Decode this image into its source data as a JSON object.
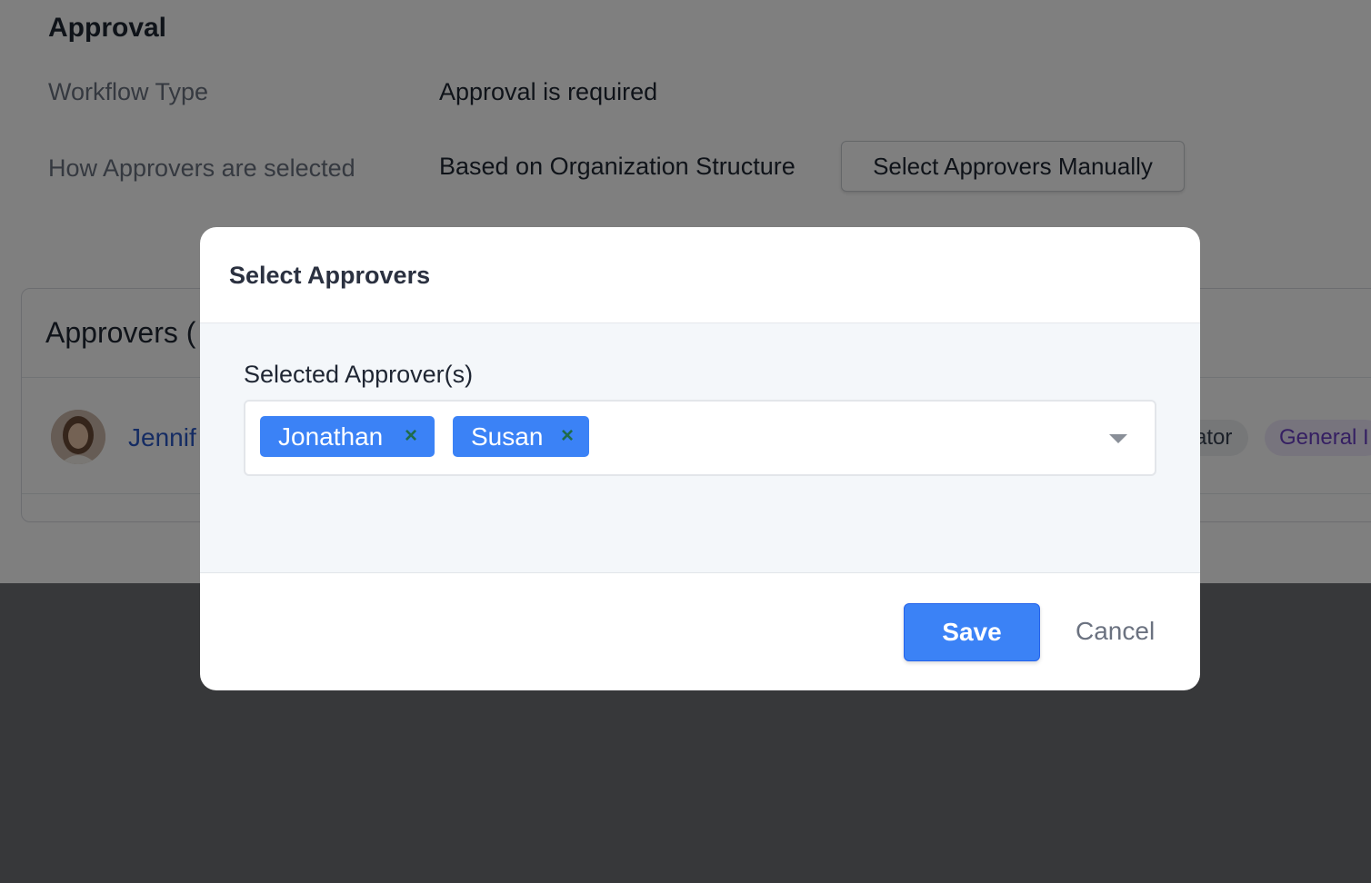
{
  "approval": {
    "title": "Approval",
    "workflow_type_label": "Workflow Type",
    "workflow_type_value": "Approval is required",
    "approvers_selected_label": "How Approvers are selected",
    "approvers_selected_value": "Based on Organization Structure",
    "manual_button_label": "Select Approvers Manually"
  },
  "approvers_card": {
    "title": "Approvers (",
    "rows": [
      {
        "name": "Jennif",
        "role_tag": "ator",
        "group_tag": "General I"
      }
    ]
  },
  "modal": {
    "title": "Select Approvers",
    "field_label": "Selected Approver(s)",
    "selected": [
      {
        "label": "Jonathan",
        "remove": "×"
      },
      {
        "label": "Susan",
        "remove": "×"
      }
    ],
    "save_label": "Save",
    "cancel_label": "Cancel"
  },
  "colors": {
    "primary": "#3b82f6",
    "link": "#2b58c7",
    "remove_icon": "#1f6b4a",
    "tag_purple_text": "#6b3fc5"
  },
  "icons": {
    "chip_remove": "close-icon",
    "dropdown": "chevron-down-icon",
    "avatar": "user-avatar"
  }
}
